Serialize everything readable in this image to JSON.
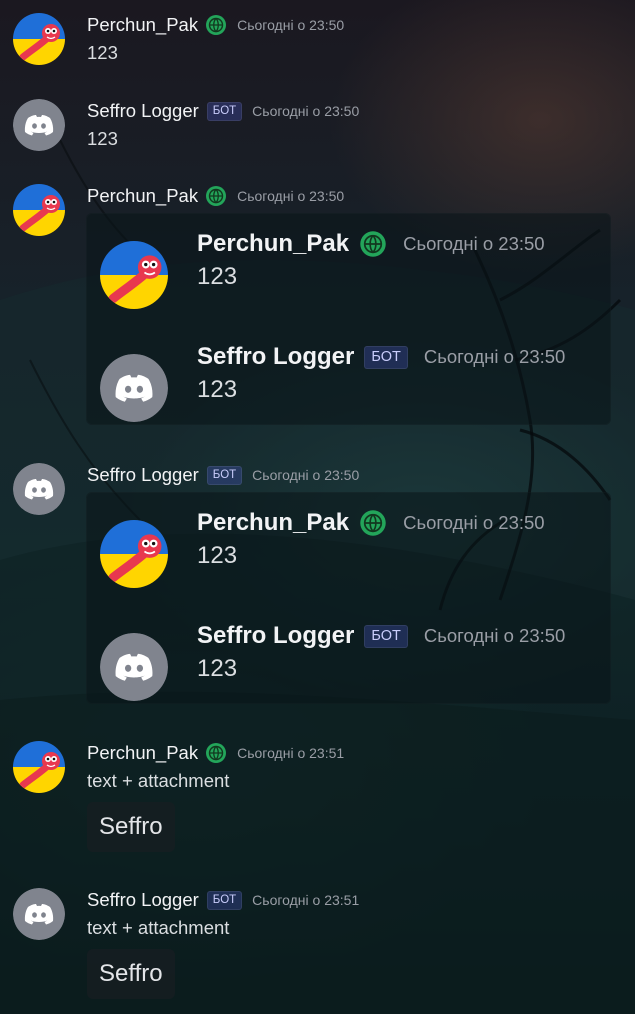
{
  "colors": {
    "username": "#f2f3f5",
    "timestamp": "#9a9ea6",
    "text": "#dbdee1",
    "globe_badge": "#23a55a",
    "discord_default_avatar": "#80848e",
    "bot_tag_bg": "#3c4270"
  },
  "messages": [
    {
      "username": "Perchun_Pak",
      "avatar": "perchun-avatar",
      "badge": "globe-icon",
      "timestamp": "Сьогодні о 23:50",
      "text": "123"
    },
    {
      "username": "Seffro Logger",
      "avatar": "discord-avatar",
      "bot_tag": "БОТ",
      "timestamp": "Сьогодні о 23:50",
      "text": "123"
    },
    {
      "username": "Perchun_Pak",
      "avatar": "perchun-avatar",
      "badge": "globe-icon",
      "timestamp": "Сьогодні о 23:50",
      "embed": [
        {
          "username": "Perchun_Pak",
          "badge": "globe-icon",
          "timestamp": "Сьогодні о 23:50",
          "text": "123"
        },
        {
          "username": "Seffro Logger",
          "bot_tag": "БОТ",
          "timestamp": "Сьогодні о 23:50",
          "text": "123"
        }
      ]
    },
    {
      "username": "Seffro Logger",
      "avatar": "discord-avatar",
      "bot_tag": "БОТ",
      "timestamp": "Сьогодні о 23:50",
      "embed": [
        {
          "username": "Perchun_Pak",
          "badge": "globe-icon",
          "timestamp": "Сьогодні о 23:50",
          "text": "123"
        },
        {
          "username": "Seffro Logger",
          "bot_tag": "БОТ",
          "timestamp": "Сьогодні о 23:50",
          "text": "123"
        }
      ]
    },
    {
      "username": "Perchun_Pak",
      "avatar": "perchun-avatar",
      "badge": "globe-icon",
      "timestamp": "Сьогодні о 23:51",
      "text": "text + attachment",
      "attachment": "Seffro"
    },
    {
      "username": "Seffro Logger",
      "avatar": "discord-avatar",
      "bot_tag": "БОТ",
      "timestamp": "Сьогодні о 23:51",
      "text": "text + attachment",
      "attachment": "Seffro"
    }
  ]
}
